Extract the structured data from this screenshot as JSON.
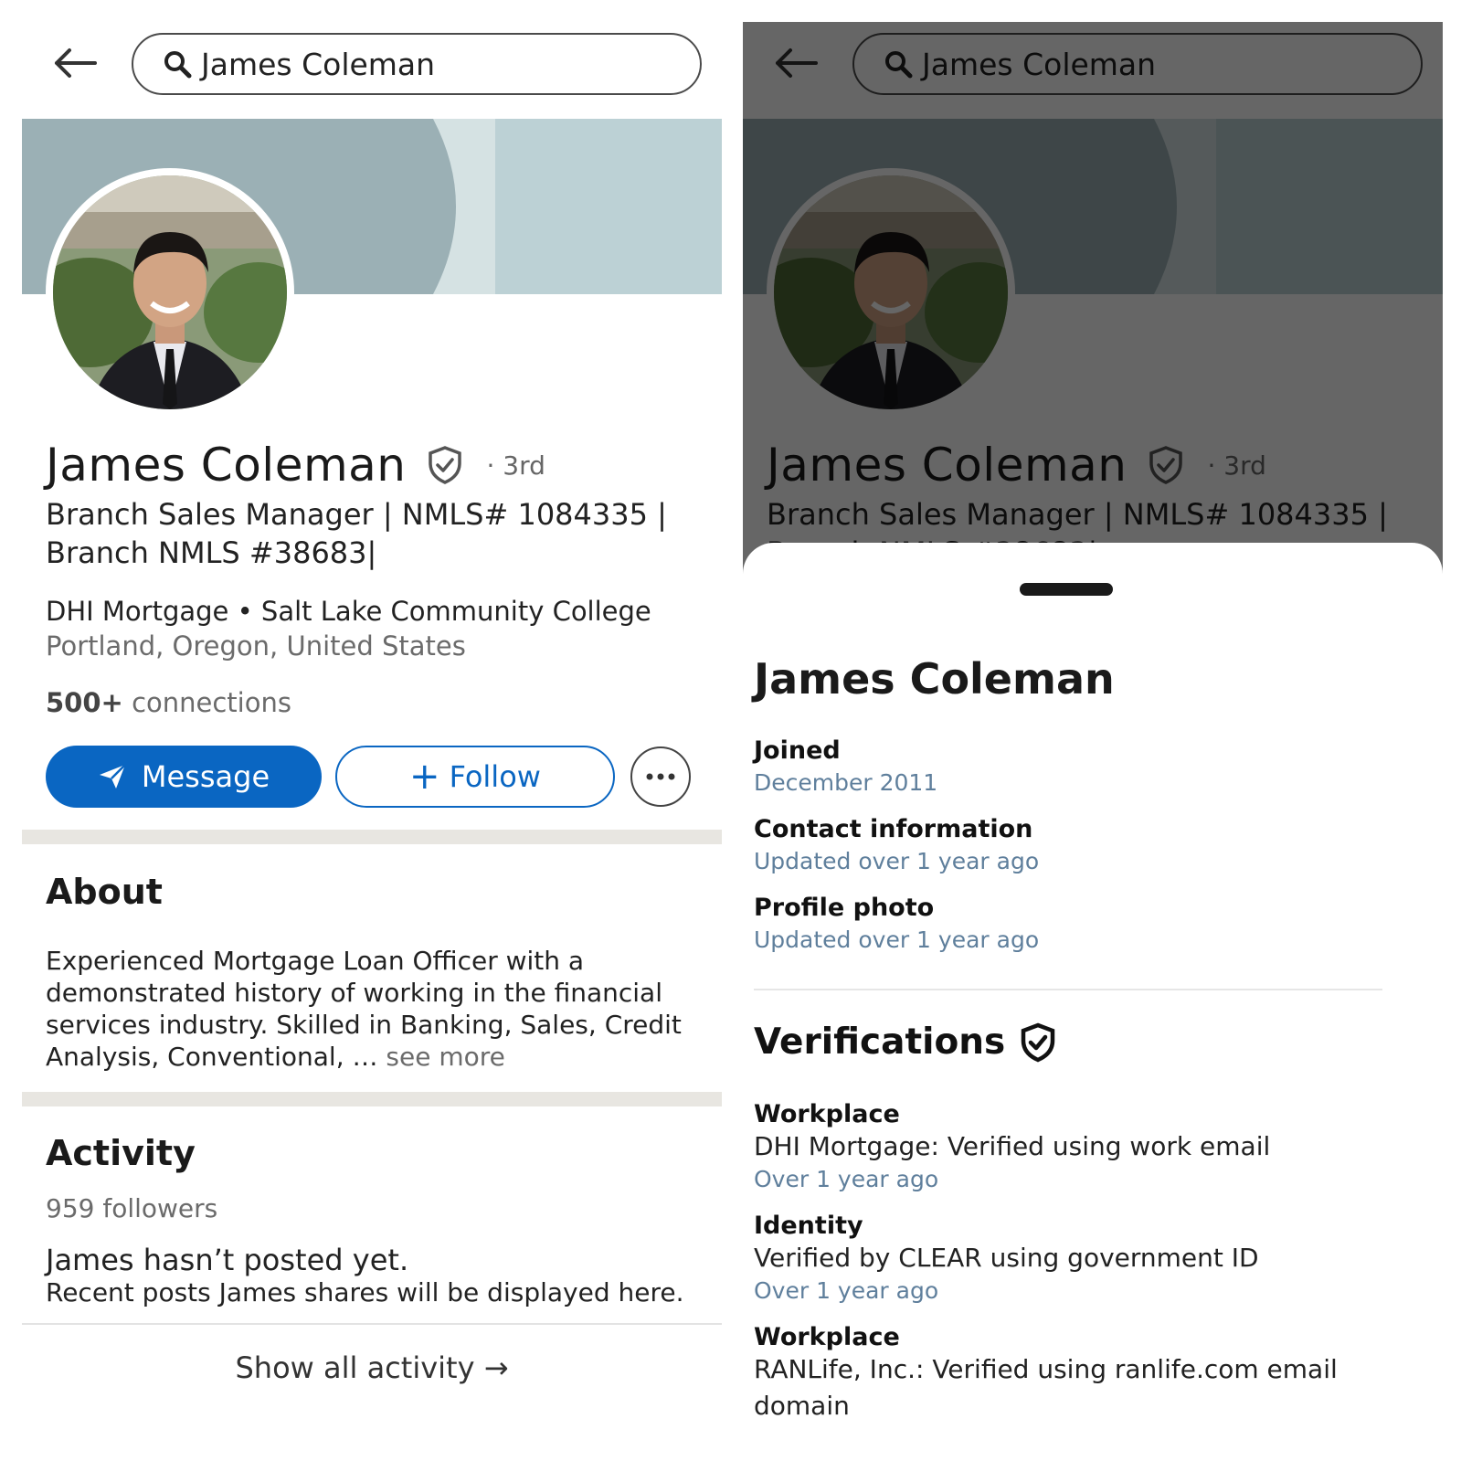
{
  "search": {
    "query": "James Coleman"
  },
  "profile": {
    "name": "James Coleman",
    "degree": "· 3rd",
    "headline": "Branch Sales Manager | NMLS# 1084335 | Branch NMLS #38683|",
    "headline_line1": "Branch Sales Manager | NMLS# 1084335 |",
    "headline_line2": "Branch NMLS #38683|",
    "work": "DHI Mortgage • Salt Lake Community College",
    "location": "Portland, Oregon, United States",
    "connections_count": "500+",
    "connections_label": "connections"
  },
  "actions": {
    "message": "Message",
    "follow": "Follow"
  },
  "about": {
    "title": "About",
    "text": "Experienced Mortgage Loan Officer with a demonstrated history of working in the financial services industry. Skilled in Banking, Sales, Credit Analysis, Conventional, …",
    "see_more": "see more"
  },
  "activity": {
    "title": "Activity",
    "followers": "959 followers",
    "empty_title": "James hasn’t posted yet.",
    "empty_sub": "Recent posts James shares will be displayed here.",
    "show_all": "Show all activity →"
  },
  "sheet": {
    "name": "James Coleman",
    "joined_label": "Joined",
    "joined_value": "December 2011",
    "contact_label": "Contact information",
    "contact_value": "Updated over 1 year ago",
    "photo_label": "Profile photo",
    "photo_value": "Updated over 1 year ago",
    "verifications_title": "Verifications",
    "verifications": [
      {
        "label": "Workplace",
        "value": "DHI Mortgage: Verified using work email",
        "time": "Over 1 year ago"
      },
      {
        "label": "Identity",
        "value": "Verified by CLEAR using government ID",
        "time": "Over 1 year ago"
      },
      {
        "label": "Workplace",
        "value": "RANLife, Inc.: Verified using ranlife.com email domain",
        "value_line1": "RANLife, Inc.: Verified using ranlife.com email",
        "value_line2": "domain"
      }
    ]
  },
  "colors": {
    "brand": "#0a66c2",
    "banner": "#9bb0b5",
    "divider": "#e8e6e1"
  },
  "icons": [
    "back-arrow-icon",
    "search-icon",
    "verified-shield-icon",
    "send-icon",
    "plus-icon",
    "more-icon"
  ]
}
